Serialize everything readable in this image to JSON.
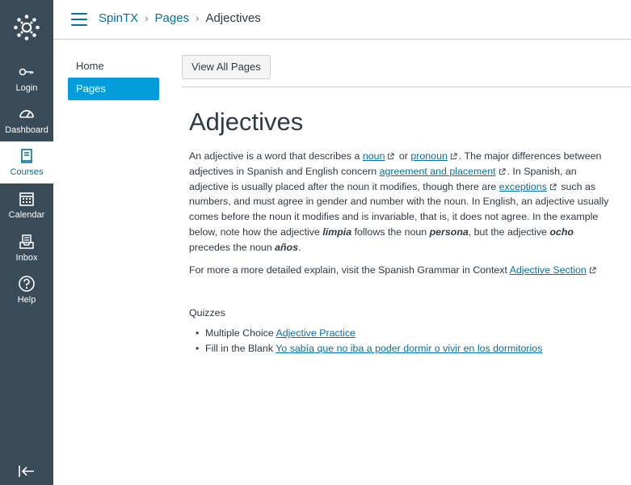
{
  "gnav": {
    "items": [
      {
        "label": "Login",
        "icon": "key-icon"
      },
      {
        "label": "Dashboard",
        "icon": "dashboard-icon"
      },
      {
        "label": "Courses",
        "icon": "courses-icon"
      },
      {
        "label": "Calendar",
        "icon": "calendar-icon"
      },
      {
        "label": "Inbox",
        "icon": "inbox-icon"
      },
      {
        "label": "Help",
        "icon": "help-icon"
      }
    ],
    "active": "Courses"
  },
  "breadcrumb": {
    "course": "SpinTX",
    "section": "Pages",
    "current": "Adjectives"
  },
  "course_nav": {
    "items": [
      {
        "label": "Home"
      },
      {
        "label": "Pages"
      }
    ],
    "active": "Pages"
  },
  "toolbar": {
    "view_all_label": "View All Pages"
  },
  "page": {
    "title": "Adjectives",
    "p1": {
      "t1": "An adjective is a word that describes a ",
      "link_noun": "noun",
      "t2": " or ",
      "link_pronoun": "pronoun",
      "t3": ". The major differences between adjectives in Spanish and English concern ",
      "link_agreement": "agreement and placement",
      "t4": ". In Spanish, an adjective is usually placed after the noun it modifies, though there are ",
      "link_exceptions": "exceptions",
      "t5": " such as numbers, and must agree in gender and number with the noun. In English, an adjective usually comes before the noun it modifies and is invariable, that is, it does not agree. In the example below, note how the adjective ",
      "em_limpia": "limpia",
      "t6": " follows the noun ",
      "em_persona": "persona",
      "t7": ", but the adjective ",
      "em_ocho": "ocho",
      "t8": " precedes the noun ",
      "em_anos": "años",
      "t9": "."
    },
    "p2": {
      "text": "For more a more detailed explain, visit the Spanish Grammar in Context ",
      "link": "Adjective Section"
    },
    "quizzes_heading": "Quizzes",
    "quizzes": [
      {
        "prefix": "Multiple Choice ",
        "link": "Adjective Practice"
      },
      {
        "prefix": "Fill in the Blank ",
        "link": "Yo sabía que no iba a poder dormir o vivir en los dormitorios"
      }
    ]
  },
  "colors": {
    "nav_bg": "#394b58",
    "link": "#0770a3",
    "active_course_nav": "#049ddc"
  }
}
